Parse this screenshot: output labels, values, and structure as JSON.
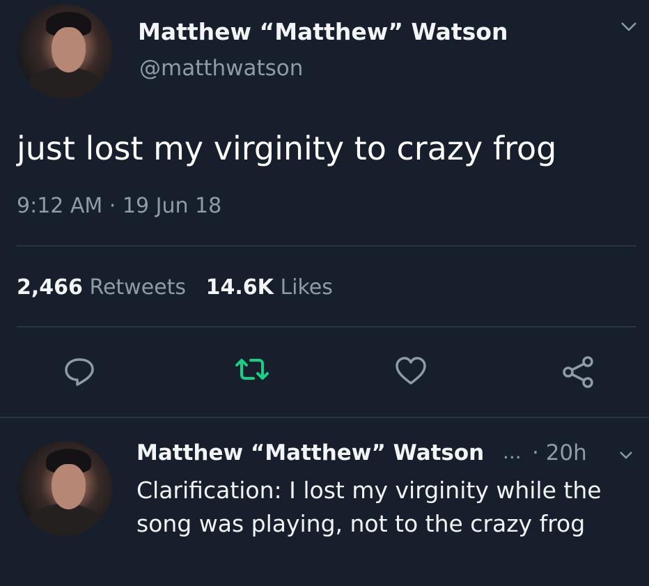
{
  "main_tweet": {
    "display_name": "Matthew “Matthew” Watson",
    "handle": "@matthwatson",
    "text": "just lost my virginity to crazy frog",
    "timestamp": "9:12 AM · 19 Jun 18",
    "retweets_count": "2,466",
    "retweets_label": "Retweets",
    "likes_count": "14.6K",
    "likes_label": "Likes",
    "actions": [
      "reply-icon",
      "retweet-icon",
      "heart-icon",
      "share-icon"
    ]
  },
  "reply": {
    "display_name": "Matthew “Matthew” Watson",
    "ellipsis": "...",
    "time": "· 20h",
    "text": "Clarification: I lost my virginity while the song was playing, not to the crazy frog"
  },
  "colors": {
    "background": "#161f2b",
    "secondary_text": "#8f9ba8",
    "retweet_active": "#19cf86"
  }
}
